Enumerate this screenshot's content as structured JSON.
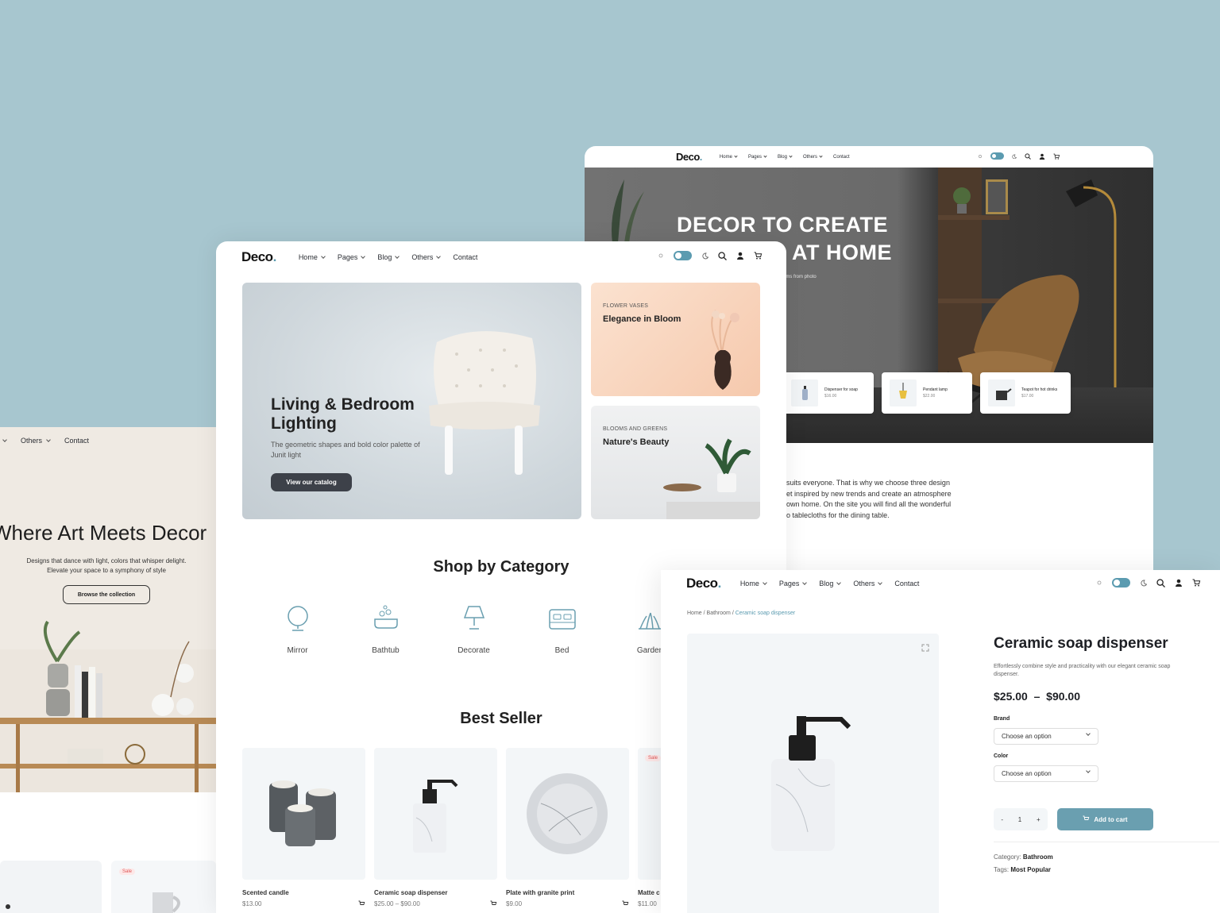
{
  "colors": {
    "background": "#a7c6cf",
    "accent": "#5b9bb0",
    "button_dark": "#3d4149",
    "cart_button": "#6a9fb0",
    "sale": "#e05757"
  },
  "brand": {
    "logo": "Deco",
    "dot": "."
  },
  "nav": {
    "home": "Home",
    "pages": "Pages",
    "blog": "Blog",
    "others": "Others",
    "contact": "Contact",
    "icons": [
      "sun-icon",
      "theme-toggle",
      "moon-icon",
      "search-icon",
      "user-icon",
      "cart-icon"
    ]
  },
  "pageA": {
    "hero_line1": "DECOR TO CREATE",
    "hero_line2": "AT HOME",
    "hero_sub": "ems from photo",
    "mini_products": [
      {
        "name": "Dispenser for soap",
        "price": "$16.00"
      },
      {
        "name": "Pendant lamp",
        "price": "$22.00"
      },
      {
        "name": "Teapot for hot drinks",
        "price": "$17.00"
      }
    ],
    "text_lines": [
      "suits everyone. That is why we choose three design",
      "et inspired by new trends and create an atmosphere",
      "own home. On the site you will find all the wonderful",
      "o tablecloths for the dining table."
    ]
  },
  "pageB": {
    "nav_others": "Others",
    "nav_contact": "Contact",
    "headline": "Where Art Meets Decor",
    "sub_line1": "Designs that dance with light, colors that whisper delight.",
    "sub_line2": "Elevate your space to a symphony of style",
    "button": "Browse the collection",
    "sale": "Sale"
  },
  "pageC": {
    "hero_title_1": "Living & Bedroom",
    "hero_title_2": "Lighting",
    "hero_desc": "The geometric shapes and bold color palette of Junit light",
    "hero_button": "View our catalog",
    "side1_kicker": "FLOWER VASES",
    "side1_title": "Elegance in Bloom",
    "side2_kicker": "BLOOMS AND GREENS",
    "side2_title": "Nature's Beauty",
    "category_title": "Shop by Category",
    "categories": [
      "Mirror",
      "Bathtub",
      "Decorate",
      "Bed",
      "Garden"
    ],
    "best_title": "Best Seller",
    "products": [
      {
        "name": "Scented candle",
        "price": "$13.00"
      },
      {
        "name": "Ceramic soap dispenser",
        "price": "$25.00 – $90.00"
      },
      {
        "name": "Plate with granite print",
        "price": "$9.00"
      },
      {
        "name": "Matte c",
        "price": "$11.00"
      }
    ],
    "sale": "Sale"
  },
  "pageD": {
    "crumb_home": "Home",
    "crumb_sep": " / ",
    "crumb_cat": "Bathroom",
    "crumb_current": "Ceramic soap dispenser",
    "title": "Ceramic soap dispenser",
    "desc": "Effortlessly combine style and practicality with our elegant ceramic soap dispenser.",
    "price": "$25.00  –  $90.00",
    "brand_label": "Brand",
    "color_label": "Color",
    "select_placeholder": "Choose an option",
    "qty_minus": "-",
    "qty_value": "1",
    "qty_plus": "+",
    "add_to_cart": "Add to cart",
    "category_label": "Category:",
    "category_value": "Bathroom",
    "tags_label": "Tags:",
    "tags_value": "Most Popular"
  }
}
